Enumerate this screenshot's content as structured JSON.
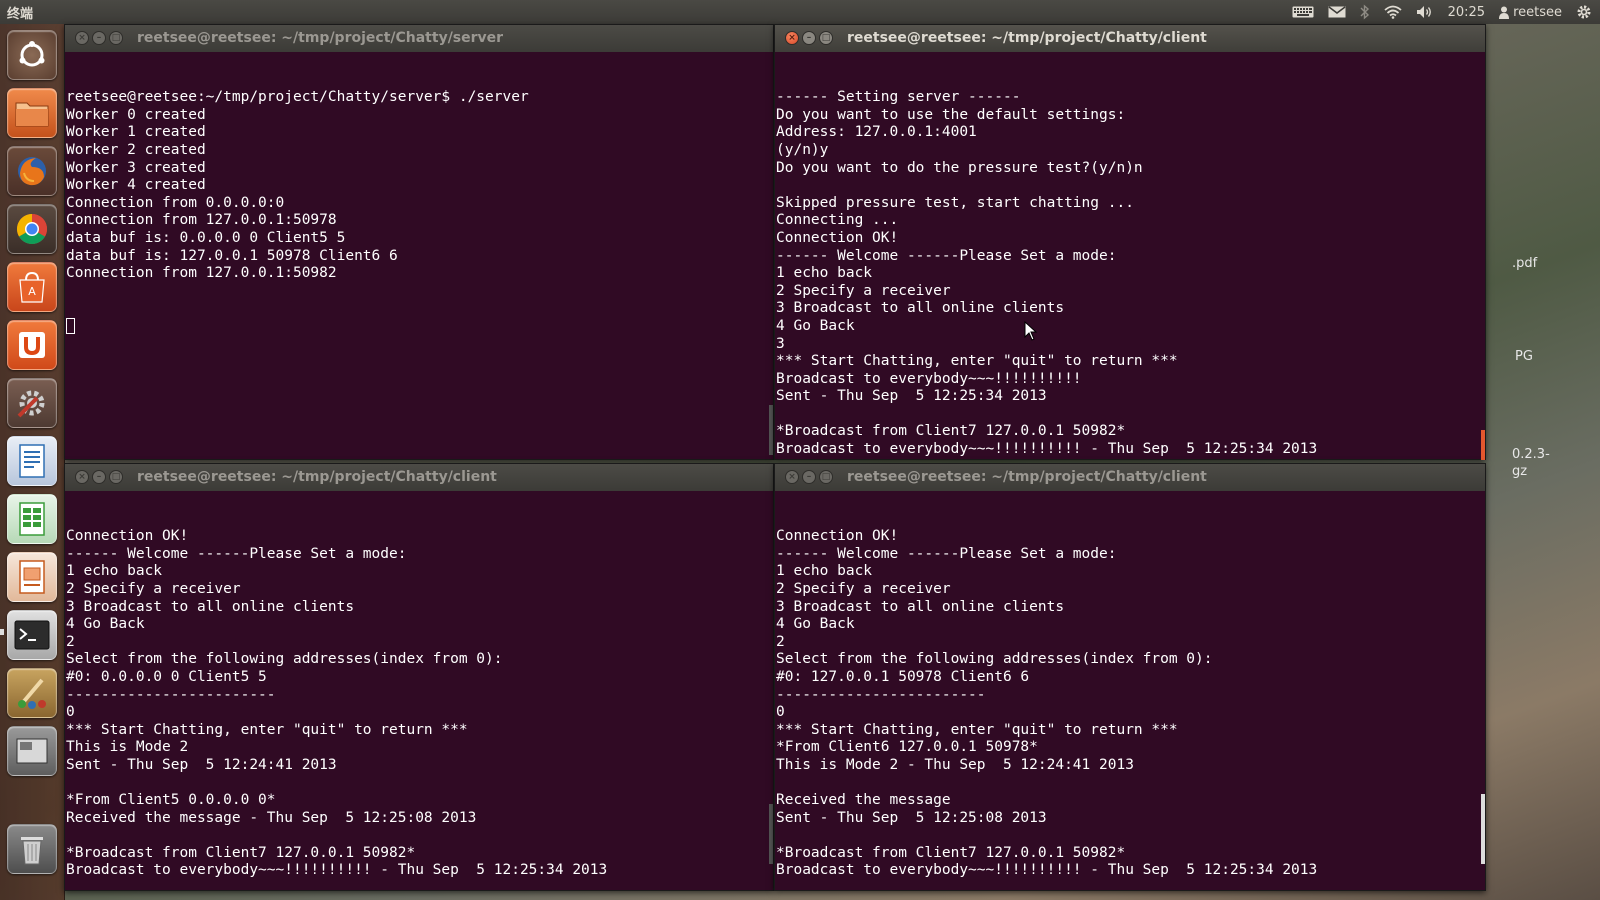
{
  "top_panel": {
    "app_name": "终端",
    "clock": "20:25",
    "user": "reetsee",
    "indicator_icons": [
      "keyboard-icon",
      "mail-icon",
      "bluetooth-icon",
      "wifi-icon",
      "volume-icon"
    ]
  },
  "desktop": {
    "file_labels": [
      ".pdf",
      "PG",
      "0.2.3-",
      "gz"
    ]
  },
  "launcher": {
    "items": [
      {
        "name": "dash-home-icon",
        "color": "#7a5a45"
      },
      {
        "name": "files-icon",
        "color": "#d96b2c"
      },
      {
        "name": "firefox-icon",
        "color": "#e5782a"
      },
      {
        "name": "chrome-icon",
        "color": "#3b78d8"
      },
      {
        "name": "software-center-icon",
        "color": "#d9531e"
      },
      {
        "name": "ubuntu-one-icon",
        "color": "#d9531e"
      },
      {
        "name": "system-settings-icon",
        "color": "#c0392b"
      },
      {
        "name": "writer-icon",
        "color": "#2f6fb3"
      },
      {
        "name": "calc-icon",
        "color": "#3a9c3a"
      },
      {
        "name": "impress-icon",
        "color": "#c55a1e"
      },
      {
        "name": "terminal-icon",
        "color": "#2c2c2c"
      },
      {
        "name": "paint-icon",
        "color": "#b88a3c"
      },
      {
        "name": "workspace-switcher-icon",
        "color": "#6b6b6b"
      },
      {
        "name": "trash-icon",
        "color": "#7a7a7a"
      }
    ]
  },
  "terminals": {
    "server": {
      "title": "reetsee@reetsee: ~/tmp/project/Chatty/server",
      "lines": [
        "reetsee@reetsee:~/tmp/project/Chatty/server$ ./server",
        "Worker 0 created",
        "Worker 1 created",
        "Worker 2 created",
        "Worker 3 created",
        "Worker 4 created",
        "Connection from 0.0.0.0:0",
        "Connection from 127.0.0.1:50978",
        "data buf is: 0.0.0.0 0 Client5 5",
        "data buf is: 127.0.0.1 50978 Client6 6",
        "Connection from 127.0.0.1:50982"
      ]
    },
    "client_top": {
      "title": "reetsee@reetsee: ~/tmp/project/Chatty/client",
      "lines": [
        "------ Setting server ------",
        "Do you want to use the default settings:",
        "Address: 127.0.0.1:4001",
        "(y/n)y",
        "Do you want to do the pressure test?(y/n)n",
        "",
        "Skipped pressure test, start chatting ...",
        "Connecting ...",
        "Connection OK!",
        "------ Welcome ------Please Set a mode:",
        "1 echo back",
        "2 Specify a receiver",
        "3 Broadcast to all online clients",
        "4 Go Back",
        "3",
        "*** Start Chatting, enter \"quit\" to return ***",
        "Broadcast to everybody~~~!!!!!!!!!!",
        "Sent - Thu Sep  5 12:25:34 2013",
        "",
        "*Broadcast from Client7 127.0.0.1 50982*",
        "Broadcast to everybody~~~!!!!!!!!!! - Thu Sep  5 12:25:34 2013"
      ]
    },
    "client_bottom_left": {
      "title": "reetsee@reetsee: ~/tmp/project/Chatty/client",
      "lines": [
        "Connection OK!",
        "------ Welcome ------Please Set a mode:",
        "1 echo back",
        "2 Specify a receiver",
        "3 Broadcast to all online clients",
        "4 Go Back",
        "2",
        "Select from the following addresses(index from 0):",
        "#0: 0.0.0.0 0 Client5 5",
        "------------------------",
        "0",
        "*** Start Chatting, enter \"quit\" to return ***",
        "This is Mode 2",
        "Sent - Thu Sep  5 12:24:41 2013",
        "",
        "*From Client5 0.0.0.0 0*",
        "Received the message - Thu Sep  5 12:25:08 2013",
        "",
        "*Broadcast from Client7 127.0.0.1 50982*",
        "Broadcast to everybody~~~!!!!!!!!!! - Thu Sep  5 12:25:34 2013"
      ]
    },
    "client_bottom_right": {
      "title": "reetsee@reetsee: ~/tmp/project/Chatty/client",
      "lines": [
        "Connection OK!",
        "------ Welcome ------Please Set a mode:",
        "1 echo back",
        "2 Specify a receiver",
        "3 Broadcast to all online clients",
        "4 Go Back",
        "2",
        "Select from the following addresses(index from 0):",
        "#0: 127.0.0.1 50978 Client6 6",
        "------------------------",
        "0",
        "*** Start Chatting, enter \"quit\" to return ***",
        "*From Client6 127.0.0.1 50978*",
        "This is Mode 2 - Thu Sep  5 12:24:41 2013",
        "",
        "Received the message",
        "Sent - Thu Sep  5 12:25:08 2013",
        "",
        "*Broadcast from Client7 127.0.0.1 50982*",
        "Broadcast to everybody~~~!!!!!!!!!! - Thu Sep  5 12:25:34 2013"
      ]
    }
  },
  "colors": {
    "terminal_bg": "#300a24",
    "panel_bg": "#3c3b37",
    "close_active": "#e4572e"
  }
}
